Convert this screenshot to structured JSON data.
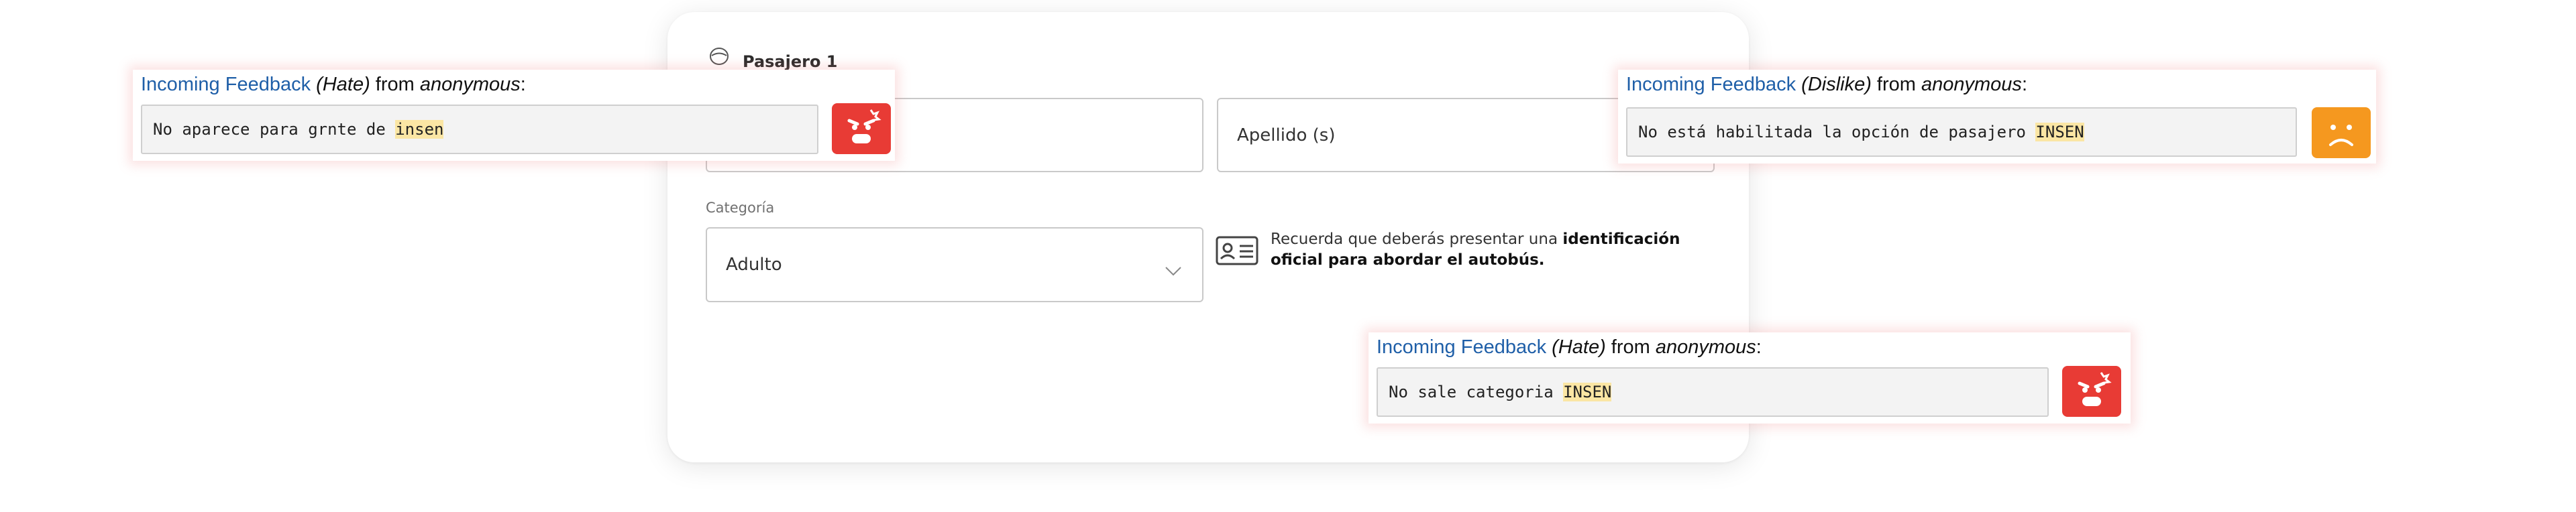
{
  "form": {
    "passenger_title": "Pasajero 1",
    "apellido_placeholder": "Apellido (s)",
    "categoria_label": "Categoría",
    "categoria_value": "Adulto",
    "id_note_prefix": "Recuerda que deberás presentar una ",
    "id_note_bold": "identificación oficial para abordar el autobús.",
    "icons": {
      "passenger": "person-outline-icon",
      "id_card": "id-card-icon",
      "dropdown": "chevron-down-icon"
    }
  },
  "feedback": [
    {
      "heading_prefix": "Incoming Feedback",
      "type": "(Hate)",
      "from_text": " from ",
      "author": "anonymous",
      "colon": ":",
      "message_text": "No aparece para grnte de ",
      "message_highlight": "insen",
      "icon": "angry-face-icon",
      "color": "#e83b35"
    },
    {
      "heading_prefix": "Incoming Feedback",
      "type": "(Dislike)",
      "from_text": " from ",
      "author": "anonymous",
      "colon": ":",
      "message_text": "No está habilitada la opción de pasajero ",
      "message_highlight": "INSEN",
      "icon": "sad-face-icon",
      "color": "#f5981f"
    },
    {
      "heading_prefix": "Incoming Feedback",
      "type": "(Hate)",
      "from_text": " from ",
      "author": "anonymous",
      "colon": ":",
      "message_text": "No sale categoria ",
      "message_highlight": "INSEN",
      "icon": "angry-face-icon",
      "color": "#e83b35"
    }
  ]
}
